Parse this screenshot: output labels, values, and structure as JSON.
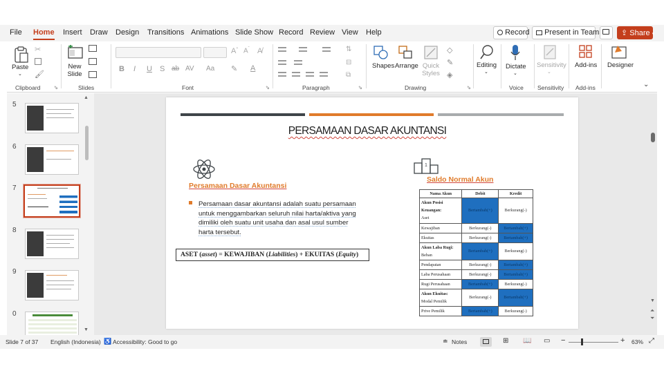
{
  "menu": {
    "tabs": [
      "File",
      "Home",
      "Insert",
      "Draw",
      "Design",
      "Transitions",
      "Animations",
      "Slide Show",
      "Record",
      "Review",
      "View",
      "Help"
    ],
    "active": "Home",
    "record_label": "Record",
    "teams_label": "Present in Teams",
    "share_label": "Share"
  },
  "ribbon": {
    "paste": "Paste",
    "new_slide": "New Slide",
    "groups": {
      "clipboard": "Clipboard",
      "slides": "Slides",
      "font": "Font",
      "paragraph": "Paragraph",
      "drawing": "Drawing",
      "voice": "Voice",
      "sensitivity": "Sensitivity",
      "addins": "Add-ins"
    },
    "shapes": "Shapes",
    "arrange": "Arrange",
    "quick_styles": "Quick Styles",
    "editing": "Editing",
    "dictate": "Dictate",
    "sensitivity": "Sensitivity",
    "addins": "Add-ins",
    "designer": "Designer"
  },
  "thumbnails": {
    "numbers": [
      "5",
      "6",
      "7",
      "8",
      "9",
      "0"
    ],
    "selected": "7"
  },
  "slide": {
    "title": "PERSAMAAN DASAR AKUNTANSI",
    "section_heading": "Persamaan Dasar Akuntansi",
    "bullet": "Persamaan dasar akuntansi adalah suatu persamaan untuk menggambarkan seluruh nilai harta/aktiva yang dimiliki oleh suatu unit usaha dan asal usul sumber harta tersebut.",
    "equation_parts": {
      "aset": "ASET (",
      "asset": "asset",
      "mid": ") = KEWAJIBAN (",
      "liabilities": "Liabilities",
      "mid2": ") + EKUITAS (",
      "equity": "Equity",
      "end": ")"
    },
    "table_title": "Saldo Normal Akun",
    "table": {
      "headers": [
        "Nama Akun",
        "Debit",
        "Kredit"
      ],
      "rows": [
        {
          "name": [
            "Akun Posisi",
            "Keuangan:",
            "Aset"
          ],
          "bold": [
            true,
            true,
            false
          ],
          "debit": "Bertambah(+)",
          "kredit": "Berkurang(-)",
          "blue": "debit"
        },
        {
          "name": [
            "Kewajiban"
          ],
          "debit": "Berkurang(-)",
          "kredit": "Bertambah(+)",
          "blue": "kredit"
        },
        {
          "name": [
            "Ekuitas"
          ],
          "debit": "Berkurang(-)",
          "kredit": "Bertambah(+)",
          "blue": "kredit"
        },
        {
          "name": [
            "Akun Laba Rugi:",
            "Beban"
          ],
          "bold": [
            true,
            false
          ],
          "debit": "Bertambah(+)",
          "kredit": "Berkurang(-)",
          "blue": "debit"
        },
        {
          "name": [
            "Pendapatan"
          ],
          "debit": "Berkurang(-)",
          "kredit": "Bertambah(+)",
          "blue": "kredit"
        },
        {
          "name": [
            "Laba Perusahaan"
          ],
          "debit": "Berkurang(-)",
          "kredit": "Bertambah(+)",
          "blue": "kredit"
        },
        {
          "name": [
            "Rugi Perusahaan"
          ],
          "debit": "Bertambah(+)",
          "kredit": "Berkurang(-)",
          "blue": "debit"
        },
        {
          "name": [
            "Akun Ekuitas:",
            "Modal Pemilik"
          ],
          "bold": [
            true,
            false
          ],
          "debit": "Berkurang(-)",
          "kredit": "Bertambah(+)",
          "blue": "kredit"
        },
        {
          "name": [
            "Prive Pemilik"
          ],
          "debit": "Bertambah(+)",
          "kredit": "Berkurang(-)",
          "blue": "debit"
        }
      ]
    },
    "bar_colors": [
      "#3f4549",
      "#e07b2b",
      "#a8abad"
    ],
    "accent": "#e07b2b",
    "blue": "#1f6fbf"
  },
  "status": {
    "slide_info": "Slide 7 of 37",
    "language": "English (Indonesia)",
    "accessibility": "Accessibility: Good to go",
    "notes": "Notes",
    "zoom": "63%"
  }
}
